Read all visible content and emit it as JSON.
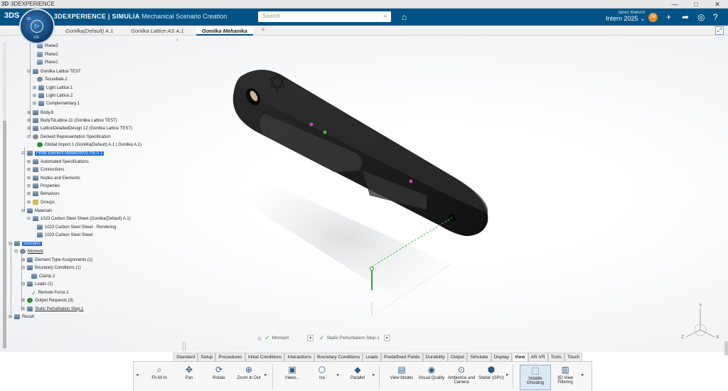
{
  "window": {
    "title": "3DEXPERIENCE",
    "controls": [
      "—",
      "□",
      "✕"
    ]
  },
  "topbar": {
    "brand": "3DEXPERIENCE | SIMULIA",
    "app_name": "Mechanical Scenario Creation",
    "search_placeholder": "Search",
    "user_name": "Janez Makorič",
    "role": "Intern 2025",
    "avatar_initials": "JM",
    "compass_version": "V,R"
  },
  "doc_tabs": [
    {
      "label": "Gonilka(Default) A.1"
    },
    {
      "label": "Gonilka Lattice AS A.1"
    },
    {
      "label": "Gonilka Mehanika",
      "active": true
    }
  ],
  "tree": [
    {
      "label": "Plane3"
    },
    {
      "label": "Plane2"
    },
    {
      "label": "Plane1"
    },
    {
      "label": "Gonilka Lattice TEST"
    },
    {
      "label": "Tessellate.2"
    },
    {
      "label": "Light Lattice.1"
    },
    {
      "label": "Light Lattice.2"
    },
    {
      "label": "Complementary.1"
    },
    {
      "label": "Body.6"
    },
    {
      "label": "BodyToLattice.11 (Gonilka Lattice TEST)"
    },
    {
      "label": "LatticeDetailedDesign.12 (Gonilka Lattice TEST)"
    },
    {
      "label": "Derived Representation Specification"
    },
    {
      "label": "Global Import.1 (Gonilka(Default) A.1 | Gonilka A.1)"
    },
    {
      "label": "Finite Element Model00001705 A.1"
    },
    {
      "label": "Automated Specifications"
    },
    {
      "label": "Connections"
    },
    {
      "label": "Nodes and Elements"
    },
    {
      "label": "Properties"
    },
    {
      "label": "Behaviors"
    },
    {
      "label": "Groups"
    },
    {
      "label": "Materials"
    },
    {
      "label": "1023 Carbon Steel Sheet (Gonilka(Default) A.1)"
    },
    {
      "label": "1023 Carbon Steel Sheet - Rendering"
    },
    {
      "label": "1023 Carbon Steel Sheet"
    },
    {
      "label": "Scenario"
    },
    {
      "label": "Moment"
    },
    {
      "label": "Element Type Assignments (1)"
    },
    {
      "label": "Boundary Conditions (1)"
    },
    {
      "label": "Clamp.2"
    },
    {
      "label": "Loads (1)"
    },
    {
      "label": "Remote Force.1"
    },
    {
      "label": "Output Requests (3)"
    },
    {
      "label": "Static Perturbation Step.1"
    },
    {
      "label": "Result"
    }
  ],
  "status": {
    "case_label": "Moment",
    "step_label": "Static Perturbation Step.1"
  },
  "ribbon_tabs": [
    "Standard",
    "Setup",
    "Procedures",
    "Initial Conditions",
    "Interactions",
    "Boundary Conditions",
    "Loads",
    "Predefined Fields",
    "Durability",
    "Output",
    "Simulate",
    "Display",
    "View",
    "AR-VR",
    "Tools",
    "Touch"
  ],
  "active_ribbon_tab": "View",
  "ribbon_buttons": [
    {
      "label": "Fit All In",
      "icon": "fit-all-icon"
    },
    {
      "label": "Pan",
      "icon": "pan-icon"
    },
    {
      "label": "Rotate",
      "icon": "rotate-icon"
    },
    {
      "label": "Zoom In Out",
      "icon": "zoom-icon"
    },
    {
      "label": "Views...",
      "icon": "views-icon"
    },
    {
      "label": "Iso",
      "icon": "iso-icon"
    },
    {
      "label": "Parallel",
      "icon": "parallel-icon"
    },
    {
      "label": "View Modes",
      "icon": "view-modes-icon"
    },
    {
      "label": "Visual Quality",
      "icon": "visual-quality-icon"
    },
    {
      "label": "Ambience and Camera",
      "icon": "ambience-icon"
    },
    {
      "label": "Stellar (GPU)",
      "icon": "stellar-icon"
    },
    {
      "label": "Volatile Ghosting",
      "icon": "ghosting-icon"
    },
    {
      "label": "3D View Filtering",
      "icon": "view-filter-icon"
    }
  ],
  "triad": {
    "x": "X",
    "y": "Y",
    "z": "Z"
  },
  "colors": {
    "topbar": "#005386",
    "part": "#1c1c1c",
    "force_line": "#3fc13f",
    "selection": "#1f6bd1"
  }
}
